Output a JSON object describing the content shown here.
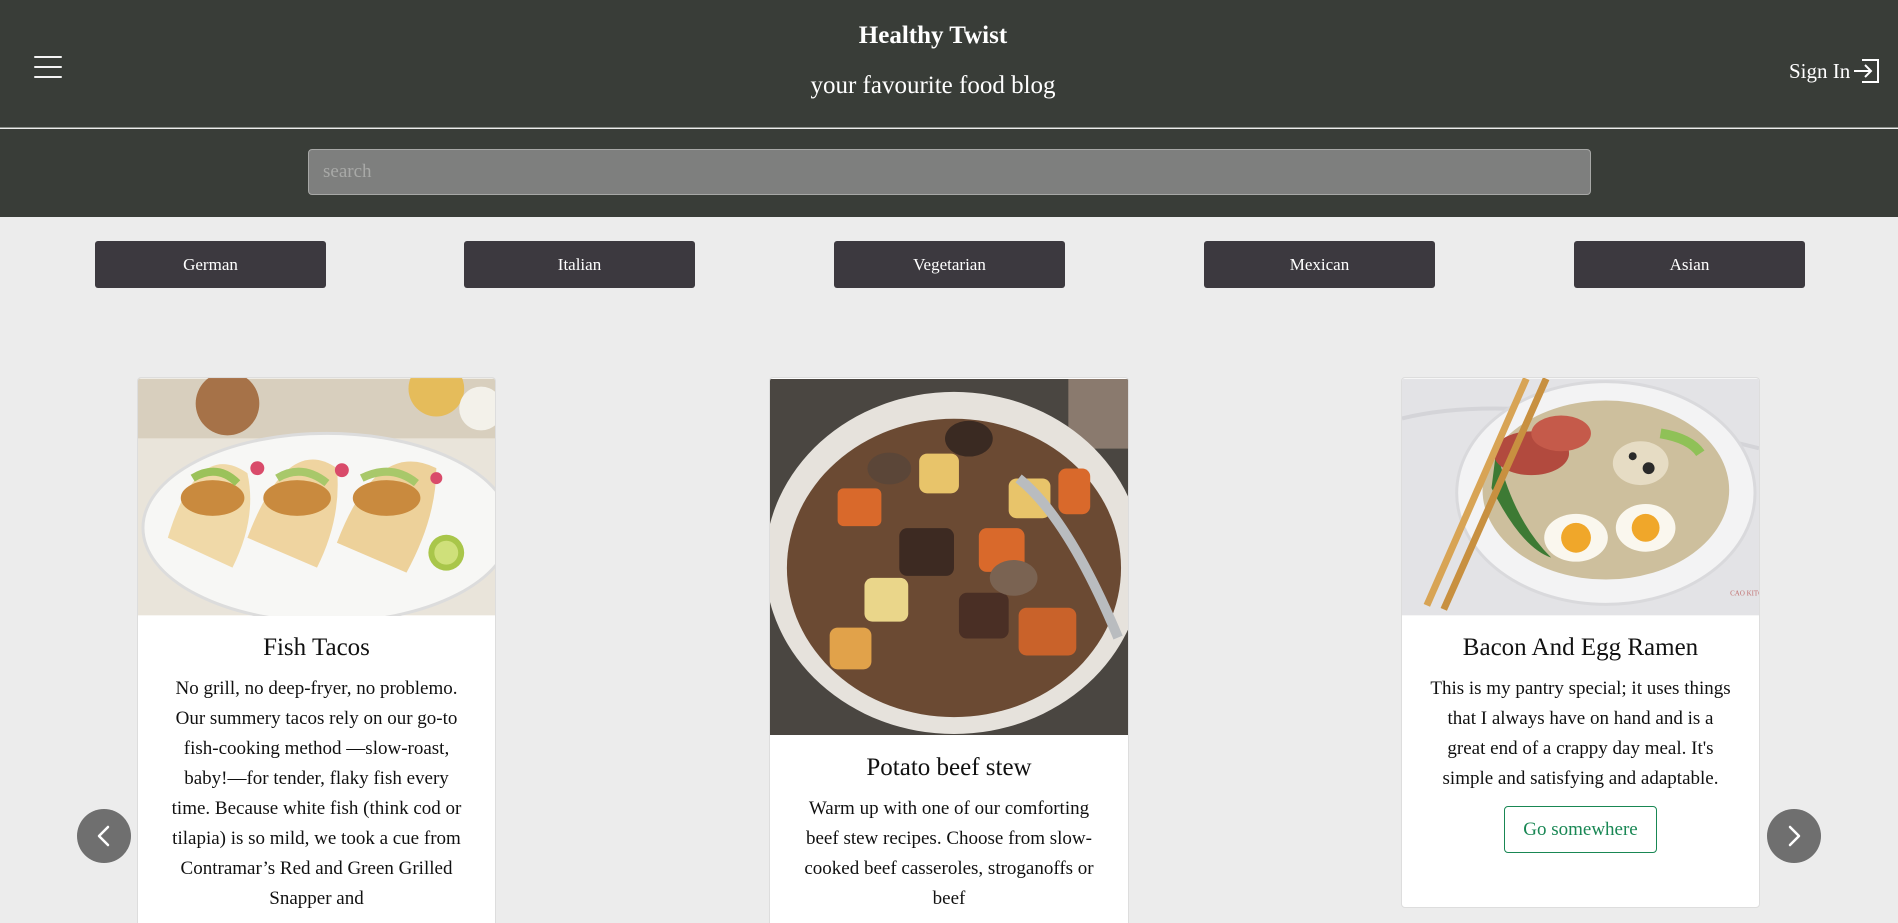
{
  "header": {
    "title": "Healthy Twist",
    "subtitle": "your favourite food blog",
    "sign_in": "Sign In"
  },
  "search": {
    "placeholder": "search"
  },
  "categories": [
    "German",
    "Italian",
    "Vegetarian",
    "Mexican",
    "Asian"
  ],
  "cards": [
    {
      "title": "Fish Tacos",
      "text": "No grill, no deep-fryer, no problemo. Our summery tacos rely on our go-to fish-cooking method —slow-roast, baby!—for tender, flaky fish every time. Because white fish (think cod or tilapia) is so mild, we took a cue from Contramar’s Red and Green Grilled Snapper and"
    },
    {
      "title": "Potato beef stew",
      "text": "Warm up with one of our comforting beef stew recipes. Choose from slow-cooked beef casseroles, stroganoffs or beef"
    },
    {
      "title": "Bacon And Egg Ramen",
      "text": "This is my pantry special; it uses things that I always have on hand and is a great end of a crappy day meal. It's simple and satisfying and adaptable.",
      "button": "Go somewhere",
      "watermark": "CAO KITCHEN"
    }
  ],
  "icons": {
    "menu": "hamburger-icon",
    "sign_in": "sign-in-icon",
    "prev": "chevron-left-icon",
    "next": "chevron-right-icon"
  },
  "colors": {
    "header_bg": "#393d38",
    "category_bg": "#3c393f",
    "accent_green": "#198754",
    "page_bg": "#ececec"
  }
}
